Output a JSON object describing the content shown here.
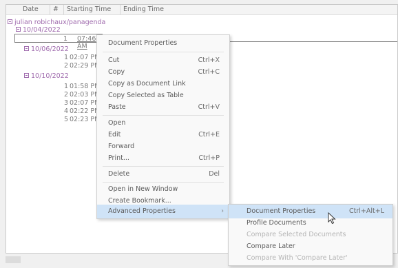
{
  "header": {
    "columns": [
      "Date",
      "#",
      "Starting Time",
      "Ending Time"
    ]
  },
  "tree": {
    "root": "julian robichaux/panagenda",
    "groups": [
      {
        "date": "10/04/2022",
        "rows": [
          {
            "num": "1",
            "time": "07:46 AM"
          }
        ]
      },
      {
        "date": "10/06/2022",
        "rows": [
          {
            "num": "1",
            "time": "02:07 PM"
          },
          {
            "num": "2",
            "time": "02:29 PM"
          }
        ]
      },
      {
        "date": "10/10/2022",
        "rows": [
          {
            "num": "1",
            "time": "01:58 PM"
          },
          {
            "num": "2",
            "time": "02:03 PM"
          },
          {
            "num": "3",
            "time": "02:07 PM"
          },
          {
            "num": "4",
            "time": "02:22 PM"
          },
          {
            "num": "5",
            "time": "02:23 PM"
          }
        ]
      }
    ]
  },
  "context_menu": {
    "items": [
      {
        "label": "Document Properties",
        "shortcut": ""
      },
      {
        "label": "Cut",
        "shortcut": "Ctrl+X"
      },
      {
        "label": "Copy",
        "shortcut": "Ctrl+C"
      },
      {
        "label": "Copy as Document Link",
        "shortcut": ""
      },
      {
        "label": "Copy Selected as Table",
        "shortcut": ""
      },
      {
        "label": "Paste",
        "shortcut": "Ctrl+V"
      },
      {
        "label": "Open",
        "shortcut": ""
      },
      {
        "label": "Edit",
        "shortcut": "Ctrl+E"
      },
      {
        "label": "Forward",
        "shortcut": ""
      },
      {
        "label": "Print...",
        "shortcut": "Ctrl+P"
      },
      {
        "label": "Delete",
        "shortcut": "Del"
      },
      {
        "label": "Open in New Window",
        "shortcut": ""
      },
      {
        "label": "Create Bookmark...",
        "shortcut": ""
      },
      {
        "label": "Advanced Properties",
        "shortcut": ""
      }
    ]
  },
  "submenu": {
    "items": [
      {
        "label": "Document Properties",
        "shortcut": "Ctrl+Alt+L"
      },
      {
        "label": "Profile Documents",
        "shortcut": ""
      },
      {
        "label": "Compare Selected Documents",
        "shortcut": ""
      },
      {
        "label": "Compare Later",
        "shortcut": ""
      },
      {
        "label": "Compare With 'Compare Later'",
        "shortcut": ""
      }
    ]
  },
  "colors": {
    "category": "#a06cae",
    "hover": "#cfe3f7",
    "disabled": "#b4b4b4"
  },
  "icons": {
    "submenu_arrow": "chevron-right-icon",
    "cursor": "mouse-pointer-icon",
    "expander": "collapse-box-icon"
  }
}
